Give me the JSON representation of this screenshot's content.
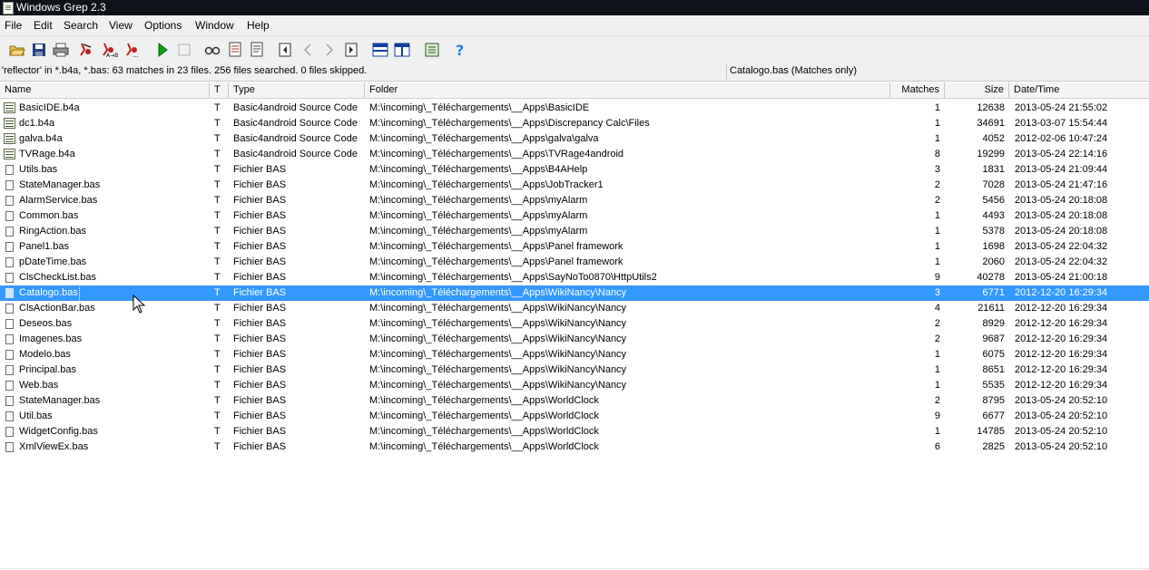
{
  "window": {
    "title": "Windows Grep 2.3"
  },
  "menu": [
    "File",
    "Edit",
    "Search",
    "View",
    "Options",
    "Window",
    "Help"
  ],
  "toolbar": [
    {
      "name": "open-folder-icon",
      "color": "#d8a020"
    },
    {
      "name": "save-icon",
      "color": "#1f3f7f"
    },
    {
      "name": "print-icon",
      "color": "#505050"
    },
    {
      "name": "search-icon",
      "color": "#c02020"
    },
    {
      "name": "replace-icon",
      "color": "#c02020"
    },
    {
      "name": "search-more-icon",
      "color": "#c02020"
    },
    {
      "name": "play-icon",
      "color": "#10a010"
    },
    {
      "name": "stop-icon",
      "color": "#b0b0b0"
    },
    {
      "name": "view-icon",
      "color": "#303030"
    },
    {
      "name": "document-list-icon",
      "color": "#a03020"
    },
    {
      "name": "document-icon",
      "color": "#404040"
    },
    {
      "name": "first-icon",
      "color": "#303030"
    },
    {
      "name": "prev-icon",
      "color": "#a0a0a0"
    },
    {
      "name": "next-icon",
      "color": "#a0a0a0"
    },
    {
      "name": "last-icon",
      "color": "#303030"
    },
    {
      "name": "split-horizontal-icon",
      "color": "#1040a0"
    },
    {
      "name": "split-vertical-icon",
      "color": "#1040a0"
    },
    {
      "name": "report-icon",
      "color": "#206020"
    },
    {
      "name": "help-icon",
      "color": "#2080e0"
    }
  ],
  "status": {
    "left": "'reflector' in *.b4a, *.bas: 63 matches in 23 files. 256 files searched. 0 files skipped.",
    "right": "Catalogo.bas (Matches only)"
  },
  "columns": {
    "name": "Name",
    "t": "T",
    "type": "Type",
    "folder": "Folder",
    "matches": "Matches",
    "size": "Size",
    "date": "Date/Time"
  },
  "files": [
    {
      "icon": "b4a",
      "name": "BasicIDE.b4a",
      "t": "T",
      "type": "Basic4android Source Code",
      "folder": "M:\\incoming\\_Téléchargements\\__Apps\\BasicIDE",
      "matches": "1",
      "size": "12638",
      "date": "2013-05-24 21:55:02"
    },
    {
      "icon": "b4a",
      "name": "dc1.b4a",
      "t": "T",
      "type": "Basic4android Source Code",
      "folder": "M:\\incoming\\_Téléchargements\\__Apps\\Discrepancy Calc\\Files",
      "matches": "1",
      "size": "34691",
      "date": "2013-03-07 15:54:44"
    },
    {
      "icon": "b4a",
      "name": "galva.b4a",
      "t": "T",
      "type": "Basic4android Source Code",
      "folder": "M:\\incoming\\_Téléchargements\\__Apps\\galva\\galva",
      "matches": "1",
      "size": "4052",
      "date": "2012-02-06 10:47:24"
    },
    {
      "icon": "b4a",
      "name": "TVRage.b4a",
      "t": "T",
      "type": "Basic4android Source Code",
      "folder": "M:\\incoming\\_Téléchargements\\__Apps\\TVRage4android",
      "matches": "8",
      "size": "19299",
      "date": "2013-05-24 22:14:16"
    },
    {
      "icon": "file",
      "name": "Utils.bas",
      "t": "T",
      "type": "Fichier BAS",
      "folder": "M:\\incoming\\_Téléchargements\\__Apps\\B4AHelp",
      "matches": "3",
      "size": "1831",
      "date": "2013-05-24 21:09:44"
    },
    {
      "icon": "file",
      "name": "StateManager.bas",
      "t": "T",
      "type": "Fichier BAS",
      "folder": "M:\\incoming\\_Téléchargements\\__Apps\\JobTracker1",
      "matches": "2",
      "size": "7028",
      "date": "2013-05-24 21:47:16"
    },
    {
      "icon": "file",
      "name": "AlarmService.bas",
      "t": "T",
      "type": "Fichier BAS",
      "folder": "M:\\incoming\\_Téléchargements\\__Apps\\myAlarm",
      "matches": "2",
      "size": "5456",
      "date": "2013-05-24 20:18:08"
    },
    {
      "icon": "file",
      "name": "Common.bas",
      "t": "T",
      "type": "Fichier BAS",
      "folder": "M:\\incoming\\_Téléchargements\\__Apps\\myAlarm",
      "matches": "1",
      "size": "4493",
      "date": "2013-05-24 20:18:08"
    },
    {
      "icon": "file",
      "name": "RingAction.bas",
      "t": "T",
      "type": "Fichier BAS",
      "folder": "M:\\incoming\\_Téléchargements\\__Apps\\myAlarm",
      "matches": "1",
      "size": "5378",
      "date": "2013-05-24 20:18:08"
    },
    {
      "icon": "file",
      "name": "Panel1.bas",
      "t": "T",
      "type": "Fichier BAS",
      "folder": "M:\\incoming\\_Téléchargements\\__Apps\\Panel framework",
      "matches": "1",
      "size": "1698",
      "date": "2013-05-24 22:04:32"
    },
    {
      "icon": "file",
      "name": "pDateTime.bas",
      "t": "T",
      "type": "Fichier BAS",
      "folder": "M:\\incoming\\_Téléchargements\\__Apps\\Panel framework",
      "matches": "1",
      "size": "2060",
      "date": "2013-05-24 22:04:32"
    },
    {
      "icon": "file",
      "name": "ClsCheckList.bas",
      "t": "T",
      "type": "Fichier BAS",
      "folder": "M:\\incoming\\_Téléchargements\\__Apps\\SayNoTo0870\\HttpUtils2",
      "matches": "9",
      "size": "40278",
      "date": "2013-05-24 21:00:18"
    },
    {
      "icon": "file",
      "name": "Catalogo.bas",
      "t": "T",
      "type": "Fichier BAS",
      "folder": "M:\\incoming\\_Téléchargements\\__Apps\\WikiNancy\\Nancy",
      "matches": "3",
      "size": "6771",
      "date": "2012-12-20 16:29:34",
      "selected": true
    },
    {
      "icon": "file",
      "name": "ClsActionBar.bas",
      "t": "T",
      "type": "Fichier BAS",
      "folder": "M:\\incoming\\_Téléchargements\\__Apps\\WikiNancy\\Nancy",
      "matches": "4",
      "size": "21611",
      "date": "2012-12-20 16:29:34"
    },
    {
      "icon": "file",
      "name": "Deseos.bas",
      "t": "T",
      "type": "Fichier BAS",
      "folder": "M:\\incoming\\_Téléchargements\\__Apps\\WikiNancy\\Nancy",
      "matches": "2",
      "size": "8929",
      "date": "2012-12-20 16:29:34"
    },
    {
      "icon": "file",
      "name": "Imagenes.bas",
      "t": "T",
      "type": "Fichier BAS",
      "folder": "M:\\incoming\\_Téléchargements\\__Apps\\WikiNancy\\Nancy",
      "matches": "2",
      "size": "9687",
      "date": "2012-12-20 16:29:34"
    },
    {
      "icon": "file",
      "name": "Modelo.bas",
      "t": "T",
      "type": "Fichier BAS",
      "folder": "M:\\incoming\\_Téléchargements\\__Apps\\WikiNancy\\Nancy",
      "matches": "1",
      "size": "6075",
      "date": "2012-12-20 16:29:34"
    },
    {
      "icon": "file",
      "name": "Principal.bas",
      "t": "T",
      "type": "Fichier BAS",
      "folder": "M:\\incoming\\_Téléchargements\\__Apps\\WikiNancy\\Nancy",
      "matches": "1",
      "size": "8651",
      "date": "2012-12-20 16:29:34"
    },
    {
      "icon": "file",
      "name": "Web.bas",
      "t": "T",
      "type": "Fichier BAS",
      "folder": "M:\\incoming\\_Téléchargements\\__Apps\\WikiNancy\\Nancy",
      "matches": "1",
      "size": "5535",
      "date": "2012-12-20 16:29:34"
    },
    {
      "icon": "file",
      "name": "StateManager.bas",
      "t": "T",
      "type": "Fichier BAS",
      "folder": "M:\\incoming\\_Téléchargements\\__Apps\\WorldClock",
      "matches": "2",
      "size": "8795",
      "date": "2013-05-24 20:52:10"
    },
    {
      "icon": "file",
      "name": "Util.bas",
      "t": "T",
      "type": "Fichier BAS",
      "folder": "M:\\incoming\\_Téléchargements\\__Apps\\WorldClock",
      "matches": "9",
      "size": "6677",
      "date": "2013-05-24 20:52:10"
    },
    {
      "icon": "file",
      "name": "WidgetConfig.bas",
      "t": "T",
      "type": "Fichier BAS",
      "folder": "M:\\incoming\\_Téléchargements\\__Apps\\WorldClock",
      "matches": "1",
      "size": "14785",
      "date": "2013-05-24 20:52:10"
    },
    {
      "icon": "file",
      "name": "XmlViewEx.bas",
      "t": "T",
      "type": "Fichier BAS",
      "folder": "M:\\incoming\\_Téléchargements\\__Apps\\WorldClock",
      "matches": "6",
      "size": "2825",
      "date": "2013-05-24 20:52:10"
    }
  ]
}
